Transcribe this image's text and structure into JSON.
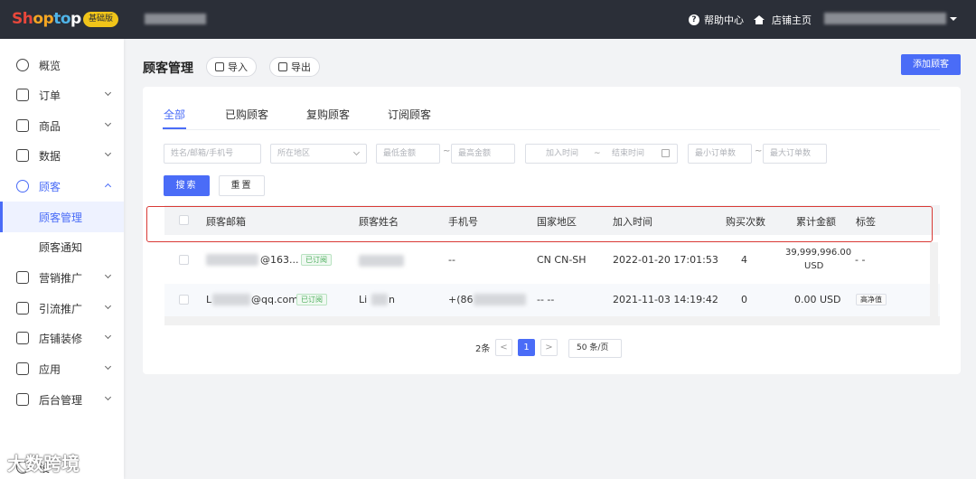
{
  "topbar": {
    "logo": [
      "Sh",
      "op",
      "to",
      "p"
    ],
    "plan": "基础版",
    "help": "帮助中心",
    "store_home": "店铺主页"
  },
  "sidebar": {
    "items": [
      {
        "label": "概览",
        "icon": "compass-icon"
      },
      {
        "label": "订单",
        "icon": "order-icon"
      },
      {
        "label": "商品",
        "icon": "product-icon"
      },
      {
        "label": "数据",
        "icon": "data-icon"
      },
      {
        "label": "顾客",
        "icon": "customer-icon"
      },
      {
        "label": "顾客管理"
      },
      {
        "label": "顾客通知"
      },
      {
        "label": "营销推广",
        "icon": "marketing-icon"
      },
      {
        "label": "引流推广",
        "icon": "traffic-icon"
      },
      {
        "label": "店铺装修",
        "icon": "decoration-icon"
      },
      {
        "label": "应用",
        "icon": "apps-icon"
      },
      {
        "label": "后台管理",
        "icon": "admin-icon"
      }
    ],
    "bottom_label": "设"
  },
  "header": {
    "title": "顾客管理",
    "import": "导入",
    "export": "导出",
    "add": "添加顾客"
  },
  "tabs": [
    "全部",
    "已购顾客",
    "复购顾客",
    "订阅顾客"
  ],
  "filters": {
    "keyword": "姓名/邮箱/手机号",
    "region": "所在地区",
    "min_amount": "最低金额",
    "max_amount": "最高金额",
    "join_start": "加入时间",
    "join_end": "结束时间",
    "min_orders": "最小订单数",
    "max_orders": "最大订单数",
    "search": "搜索",
    "reset": "重置",
    "range_sep": "~"
  },
  "table": {
    "headers": [
      "顾客邮箱",
      "顾客姓名",
      "手机号",
      "国家地区",
      "加入时间",
      "购买次数",
      "累计金额",
      "标签"
    ],
    "rows": [
      {
        "email": "@163...",
        "status": "已订阅",
        "name": "",
        "phone": "--",
        "region": "CN CN-SH",
        "joined": "2022-01-20 17:01:53",
        "orders": "4",
        "amount_1": "39,999,996.00",
        "amount_2": "USD",
        "tag": "- -"
      },
      {
        "email_prefix": "L",
        "email": "@qq.com",
        "status": "已订阅",
        "name_a": "Li",
        "name_b": "n",
        "phone": "+(86",
        "region": "-- --",
        "joined": "2021-11-03 14:19:42",
        "orders": "0",
        "amount_1": "0.00 USD",
        "tag": "高净值"
      }
    ]
  },
  "pagination": {
    "total": "2条",
    "prev": "<",
    "page": "1",
    "next": ">",
    "size": "50 条/页"
  },
  "watermark": "大数跨境"
}
